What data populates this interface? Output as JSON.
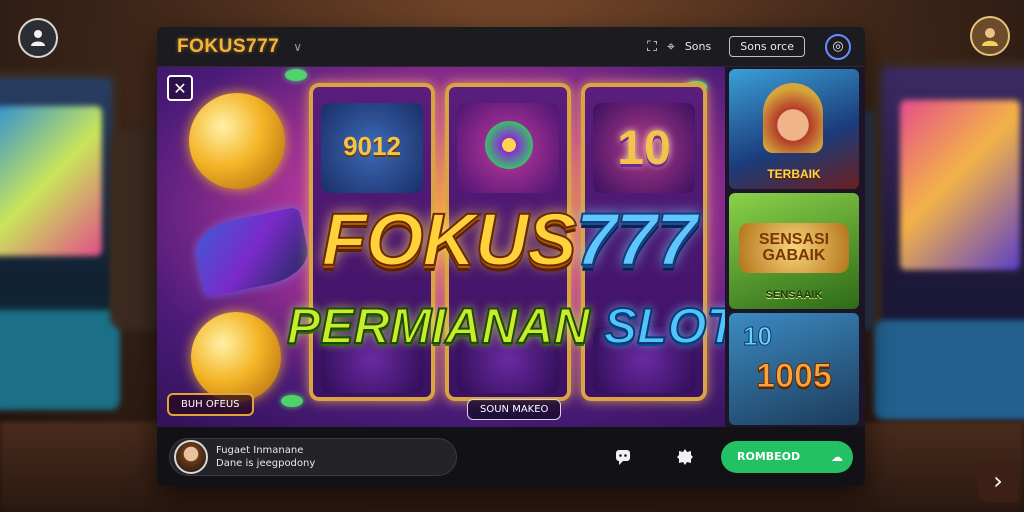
{
  "background": {
    "user_icon": "user-icon",
    "avatar_icon": "avatar-icon",
    "next_icon": "chevron-right-icon",
    "next_glyph": "›"
  },
  "window": {
    "brand": "FOKUS777",
    "brand_color": "#f3b53a",
    "brand_chevron": "∨",
    "top_icons": [
      "expand-icon",
      "location-icon"
    ],
    "top_text": "Sons",
    "top_chip": "Sons orce",
    "globe_icon": "globe-icon"
  },
  "stage": {
    "close_glyph": "✕",
    "title_main_a": "FOKUS",
    "title_main_b": "777",
    "title_sub_a": "PERMIANAN ",
    "title_sub_b": "SLOT",
    "reel1_symbol": "9012",
    "reel3_symbol": "10",
    "btn_left": "BUH OFEUS",
    "btn_mid": "SOUN MAKEO",
    "side_cards": [
      {
        "label": "TERBAIK"
      },
      {
        "big": "SENSASI GABAIK",
        "label": "SENSAAIK"
      },
      {
        "top": "10",
        "label": "1005"
      }
    ]
  },
  "bottombar": {
    "player_name": "Fugaet Inmanane",
    "player_sub": "Dane is jeegpodony",
    "icons": [
      "chat-icon",
      "settings-icon"
    ],
    "cta_label": "ROMBEOD",
    "cta_color": "#24c064",
    "cta_icon": "cloud-icon"
  }
}
